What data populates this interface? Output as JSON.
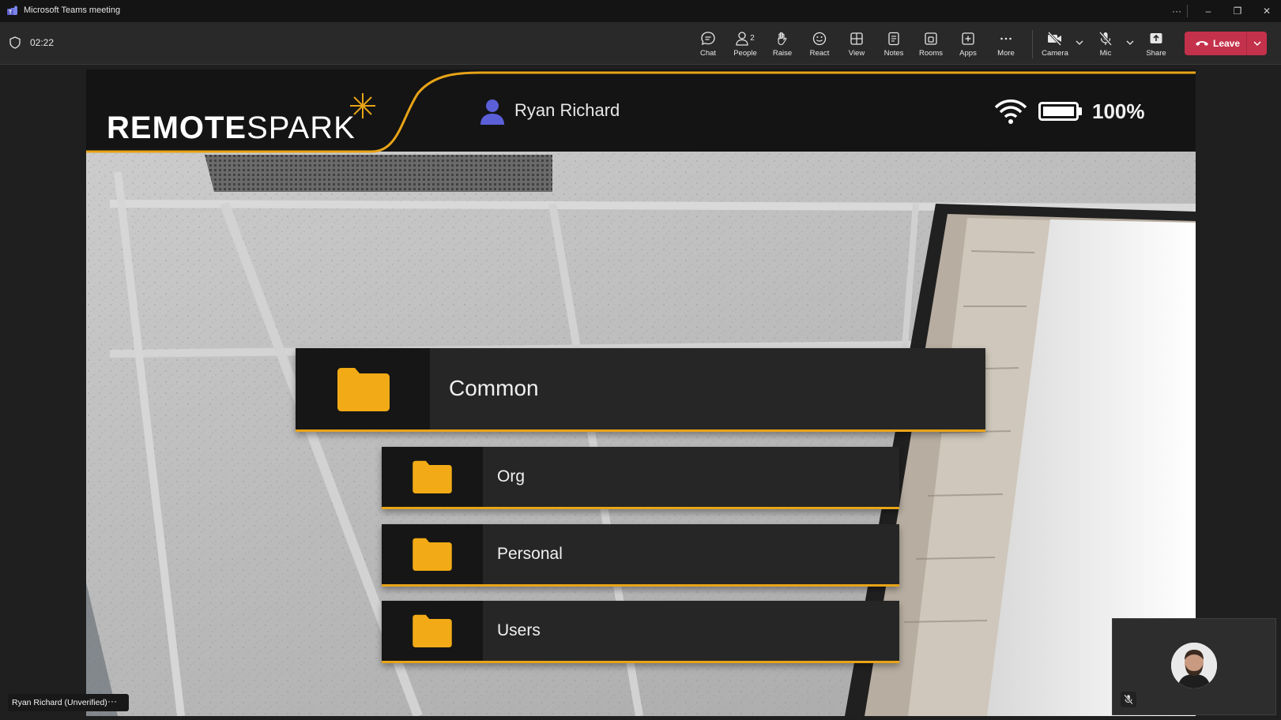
{
  "window": {
    "title": "Microsoft Teams meeting"
  },
  "meeting": {
    "timer": "02:22"
  },
  "toolbar": {
    "chat": "Chat",
    "people": "People",
    "people_count": "2",
    "raise": "Raise",
    "react": "React",
    "view": "View",
    "notes": "Notes",
    "rooms": "Rooms",
    "apps": "Apps",
    "more": "More",
    "camera": "Camera",
    "mic": "Mic",
    "share": "Share",
    "leave": "Leave"
  },
  "remote_app": {
    "brand_bold": "REMOTE",
    "brand_thin": "SPARK",
    "user_name": "Ryan Richard",
    "battery": "100%",
    "folders": [
      {
        "label": "Common",
        "level": 0
      },
      {
        "label": "Org",
        "level": 1
      },
      {
        "label": "Personal",
        "level": 1
      },
      {
        "label": "Users",
        "level": 1
      }
    ]
  },
  "participant": {
    "name": "Ryan Richard (Unverified)",
    "more": "···"
  },
  "colors": {
    "accent_gold": "#e8a417",
    "leave_red": "#c4314b",
    "teams_purple": "#5b5fc7",
    "user_icon_blue": "#5b5fd8"
  },
  "icons": [
    "teams-logo",
    "shield-icon",
    "chat-icon",
    "people-icon",
    "hand-icon",
    "smiley-icon",
    "grid-icon",
    "notes-icon",
    "rooms-icon",
    "apps-icon",
    "ellipsis-icon",
    "camera-off-icon",
    "mic-off-icon",
    "share-icon",
    "phone-hangup-icon",
    "chevron-down-icon",
    "user-icon",
    "wifi-icon",
    "battery-icon",
    "folder-icon"
  ]
}
